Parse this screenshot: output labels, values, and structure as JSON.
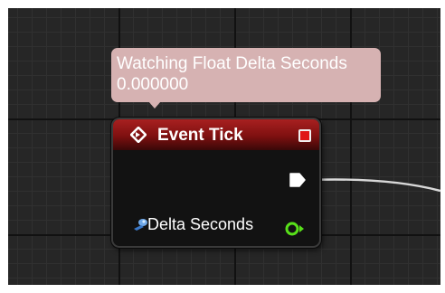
{
  "tooltip": {
    "line1": "Watching Float Delta Seconds",
    "line2": "0.000000"
  },
  "node": {
    "title": "Event Tick",
    "output_pin_label": "Delta Seconds",
    "header_color": "#a82020",
    "float_pin_color": "#58e01a",
    "delegate_pin_color": "#e01818"
  },
  "icons": {
    "event": "diamond-arrow-icon",
    "delegate": "delegate-pin-icon",
    "exec": "exec-pin-icon",
    "variable": "variable-icon",
    "float_pin": "float-pin-icon"
  }
}
